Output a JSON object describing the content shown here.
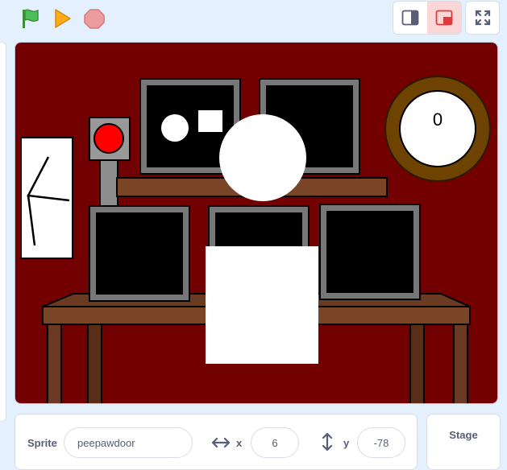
{
  "controls": {
    "green_flag": "green-flag-icon",
    "play": "play-icon",
    "stop": "stop-icon",
    "small_stage": "small-stage-icon",
    "large_stage": "large-stage-icon",
    "fullscreen": "fullscreen-icon"
  },
  "stage": {
    "counter": "0"
  },
  "sprite_info": {
    "sprite_label": "Sprite",
    "sprite_name": "peepawdoor",
    "x_label": "x",
    "x_value": "6",
    "y_label": "y",
    "y_value": "-78"
  },
  "stage_tab": {
    "label": "Stage"
  },
  "colors": {
    "stage_bg": "#720000",
    "accent_active": "#fbd6d6",
    "panel_border": "#d7deea",
    "text": "#575e75"
  }
}
